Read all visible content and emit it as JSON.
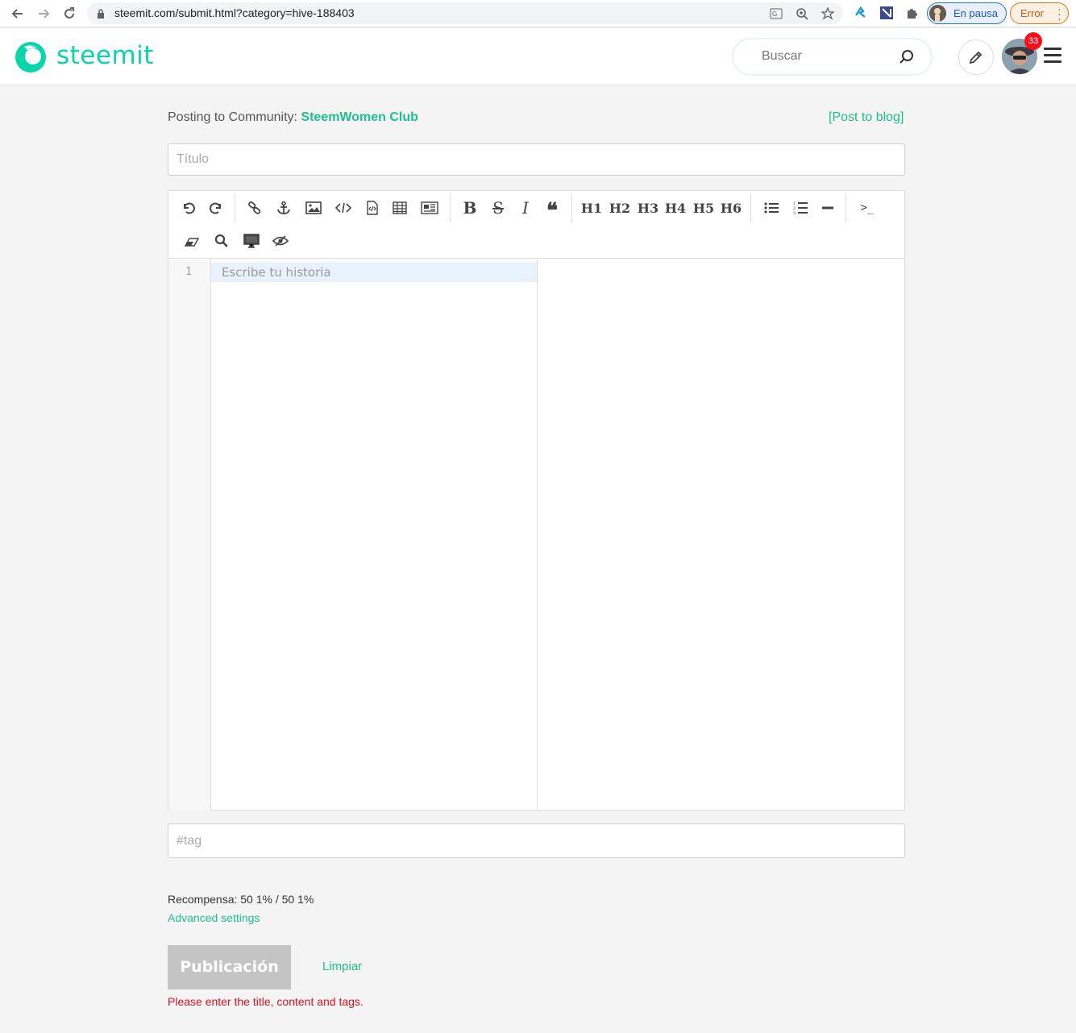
{
  "browser": {
    "url": "steemit.com/submit.html?category=hive-188403",
    "profile_label": "En pausa",
    "error_label": "Error"
  },
  "header": {
    "logo_text": "steemit",
    "search_placeholder": "Buscar",
    "notification_count": "33"
  },
  "form": {
    "posting_prefix": "Posting to Community: ",
    "community_name": "SteemWomen Club",
    "post_to_blog": "[Post to blog]",
    "title_placeholder": "Título",
    "body_placeholder": "Escribe tu historia",
    "line_number": "1",
    "tag_placeholder": "#tag",
    "reward": "Recompensa: 50 1% / 50 1%",
    "advanced_settings": "Advanced settings",
    "publish_label": "Publicación",
    "clear_label": "Limpiar",
    "error_message": "Please enter the title, content and tags."
  },
  "toolbar": {
    "headings": [
      "H1",
      "H2",
      "H3",
      "H4",
      "H5",
      "H6"
    ],
    "bold": "B",
    "strike": "S",
    "italic": "I",
    "quote": "❝",
    "terminal": ">_",
    "icons": [
      "undo-icon",
      "redo-icon",
      "link-icon",
      "anchor-icon",
      "image-icon",
      "code-icon",
      "code-file-icon",
      "table-icon",
      "columns-icon",
      "bold-icon",
      "strikethrough-icon",
      "italic-icon",
      "quote-icon",
      "bullet-list-icon",
      "numbered-list-icon",
      "horizontal-rule-icon",
      "terminal-icon",
      "eraser-icon",
      "search-icon",
      "desktop-icon",
      "preview-icon"
    ]
  },
  "colors": {
    "brand": "#07d6aa",
    "link": "#1fbf8f",
    "error": "#dd1122",
    "publish_disabled": "#c4c4c4"
  }
}
